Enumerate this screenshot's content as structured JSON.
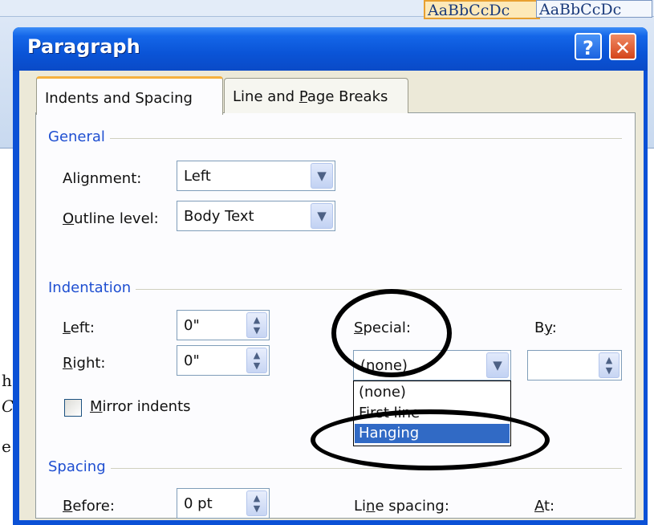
{
  "window": {
    "title": "Paragraph",
    "help_glyph": "?",
    "close_glyph": "✕"
  },
  "background": {
    "style_gallery": [
      "AaBbCcDc",
      "AaBbCcDc"
    ],
    "doc_chars": [
      "h",
      "C",
      "e"
    ]
  },
  "tabs": {
    "active": {
      "prefix": "Indents and Spacing",
      "mnemonic": "",
      "suffix": ""
    },
    "inactive": {
      "prefix": "Line and ",
      "mnemonic": "P",
      "suffix": "age Breaks"
    }
  },
  "general": {
    "group_label": "General",
    "alignment": {
      "prefix": "Ali",
      "mnemonic": "g",
      "suffix": "nment:",
      "value": "Left"
    },
    "outline_level": {
      "prefix": "",
      "mnemonic": "O",
      "suffix": "utline level:",
      "value": "Body Text"
    }
  },
  "indentation": {
    "group_label": "Indentation",
    "left": {
      "prefix": "",
      "mnemonic": "L",
      "suffix": "eft:",
      "value": "0\""
    },
    "right": {
      "prefix": "",
      "mnemonic": "R",
      "suffix": "ight:",
      "value": "0\""
    },
    "special": {
      "prefix": "",
      "mnemonic": "S",
      "suffix": "pecial:",
      "value": "(none)"
    },
    "by": {
      "prefix": "B",
      "mnemonic": "y",
      "suffix": ":",
      "value": ""
    },
    "mirror": {
      "prefix": "",
      "mnemonic": "M",
      "suffix": "irror indents",
      "checked": false
    },
    "special_options": [
      "(none)",
      "First line",
      "Hanging"
    ],
    "special_highlighted": "Hanging"
  },
  "spacing": {
    "group_label": "Spacing",
    "before": {
      "prefix": "",
      "mnemonic": "B",
      "suffix": "efore:",
      "value": "0 pt"
    },
    "line_spacing": {
      "prefix": "Li",
      "mnemonic": "n",
      "suffix": "e spacing:"
    },
    "at": {
      "prefix": "",
      "mnemonic": "A",
      "suffix": "t:"
    }
  },
  "icons": {
    "dropdown_arrow": "chevron-down-icon",
    "spin_arrows": "spin-updown-icon"
  },
  "colors": {
    "titlebar": "#0a54d7",
    "group_label": "#1f4fd1",
    "selection": "#316ac5",
    "dialog_face": "#ece9d8",
    "annotation": "#000000"
  }
}
